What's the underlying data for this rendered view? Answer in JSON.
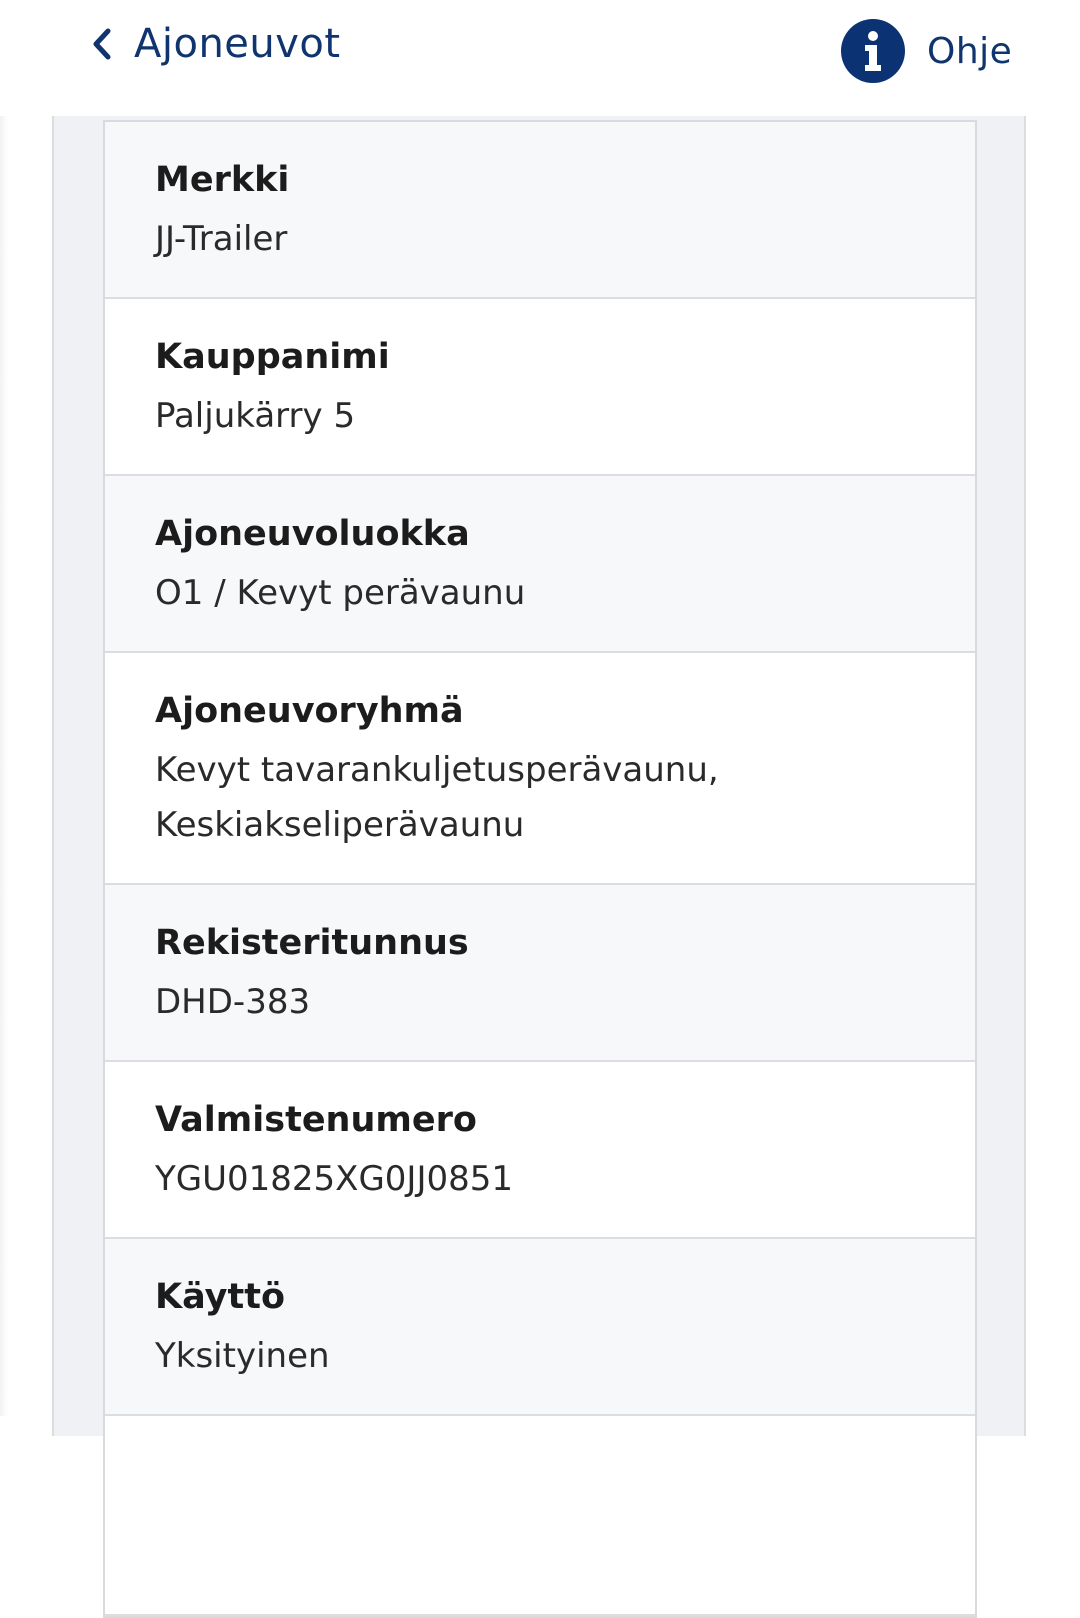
{
  "header": {
    "back_label": "Ajoneuvot",
    "back_icon": "chevron-left-icon",
    "help_label": "Ohje",
    "help_icon": "info-icon",
    "accent_color": "#0b3272"
  },
  "details": [
    {
      "label": "Merkki",
      "value": "JJ-Trailer"
    },
    {
      "label": "Kauppanimi",
      "value": "Paljukärry 5"
    },
    {
      "label": "Ajoneuvoluokka",
      "value": "O1 / Kevyt perävaunu"
    },
    {
      "label": "Ajoneuvoryhmä",
      "value": "Kevyt tavarankuljetusperävaunu,\nKeskiakseliperävaunu"
    },
    {
      "label": "Rekisteritunnus",
      "value": "DHD-383"
    },
    {
      "label": "Valmistenumero",
      "value": "YGU01825XG0JJ0851"
    },
    {
      "label": "Käyttö",
      "value": "Yksityinen"
    }
  ]
}
